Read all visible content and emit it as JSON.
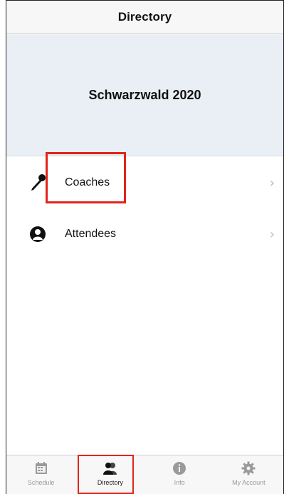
{
  "header": {
    "title": "Directory"
  },
  "event": {
    "name": "Schwarzwald 2020"
  },
  "list": {
    "items": [
      {
        "label": "Coaches",
        "icon": "microphone-icon",
        "chevron": "›"
      },
      {
        "label": "Attendees",
        "icon": "person-icon",
        "chevron": "›"
      }
    ]
  },
  "tabs": [
    {
      "label": "Schedule",
      "icon": "calendar-icon",
      "active": false
    },
    {
      "label": "Directory",
      "icon": "people-icon",
      "active": true
    },
    {
      "label": "Info",
      "icon": "info-icon",
      "active": false
    },
    {
      "label": "My Account",
      "icon": "gear-icon",
      "active": false
    }
  ],
  "colors": {
    "highlight": "#e2231a",
    "hero_bg": "#e9eff4",
    "bar_bg": "#f7f7f7"
  }
}
